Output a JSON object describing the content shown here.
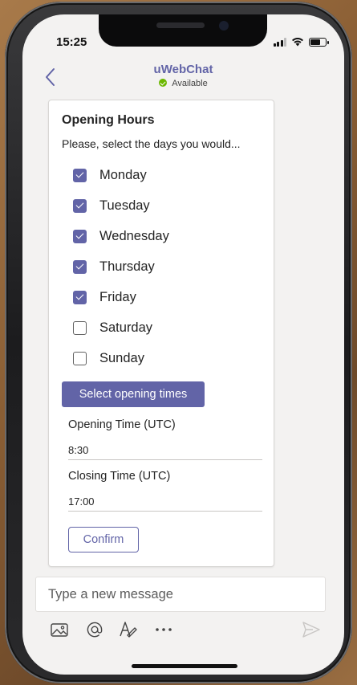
{
  "status_bar": {
    "time": "15:25",
    "battery_level": 0.7
  },
  "header": {
    "title": "uWebChat",
    "presence": "Available",
    "presence_color": "#6bb700"
  },
  "card": {
    "title": "Opening Hours",
    "subtitle": "Please, select the days you would...",
    "days": [
      {
        "label": "Monday",
        "checked": true
      },
      {
        "label": "Tuesday",
        "checked": true
      },
      {
        "label": "Wednesday",
        "checked": true
      },
      {
        "label": "Thursday",
        "checked": true
      },
      {
        "label": "Friday",
        "checked": true
      },
      {
        "label": "Saturday",
        "checked": false
      },
      {
        "label": "Sunday",
        "checked": false
      }
    ],
    "select_button_label": "Select opening times",
    "opening_label": "Opening Time (UTC)",
    "opening_value": "8:30",
    "closing_label": "Closing Time (UTC)",
    "closing_value": "17:00",
    "confirm_label": "Confirm"
  },
  "compose": {
    "placeholder": "Type a new message"
  },
  "toolbar": {
    "icons": [
      "image-icon",
      "mention-icon",
      "format-icon",
      "more-icon",
      "send-icon"
    ]
  },
  "colors": {
    "accent": "#6264a7",
    "background": "#f3f2f1"
  }
}
